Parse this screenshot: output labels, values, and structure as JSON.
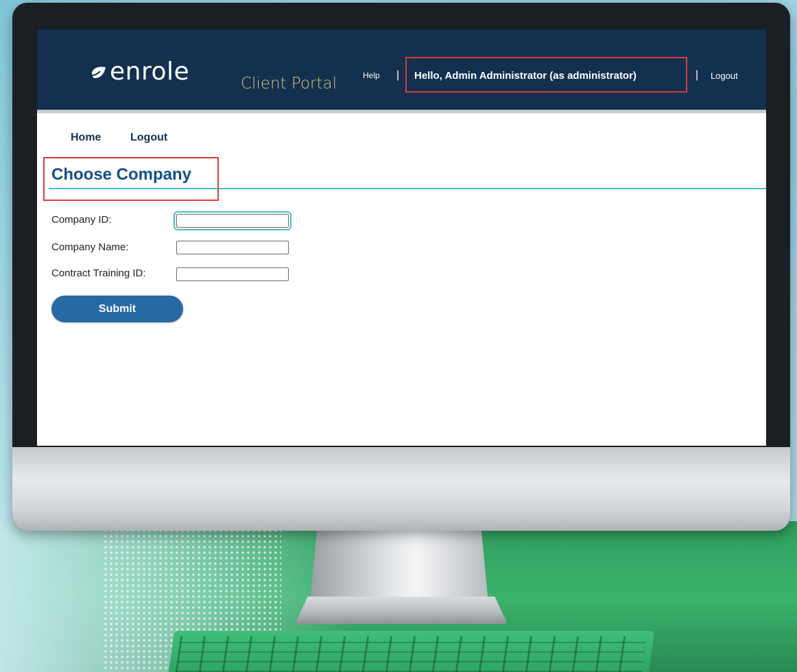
{
  "header": {
    "logo_text": "enrole",
    "portal_title": "Client Portal",
    "help_label": "Help",
    "separator": "|",
    "greeting": "Hello,  Admin Administrator (as administrator)",
    "logout_label": "Logout"
  },
  "nav": {
    "home_label": "Home",
    "logout_label": "Logout"
  },
  "page": {
    "title": "Choose Company"
  },
  "form": {
    "fields": [
      {
        "label": "Company ID:",
        "value": ""
      },
      {
        "label": "Company Name:",
        "value": ""
      },
      {
        "label": "Contract Training ID:",
        "value": ""
      }
    ],
    "submit_label": "Submit"
  },
  "colors": {
    "header_bg": "#13304f",
    "portal_gold": "#d8c47a",
    "title_blue": "#134f8a",
    "accent_teal": "#4bbccc",
    "button_blue": "#276aa3",
    "highlight_red": "#e03b3b"
  },
  "icons": {
    "logo_mark": "leaf-icon"
  }
}
